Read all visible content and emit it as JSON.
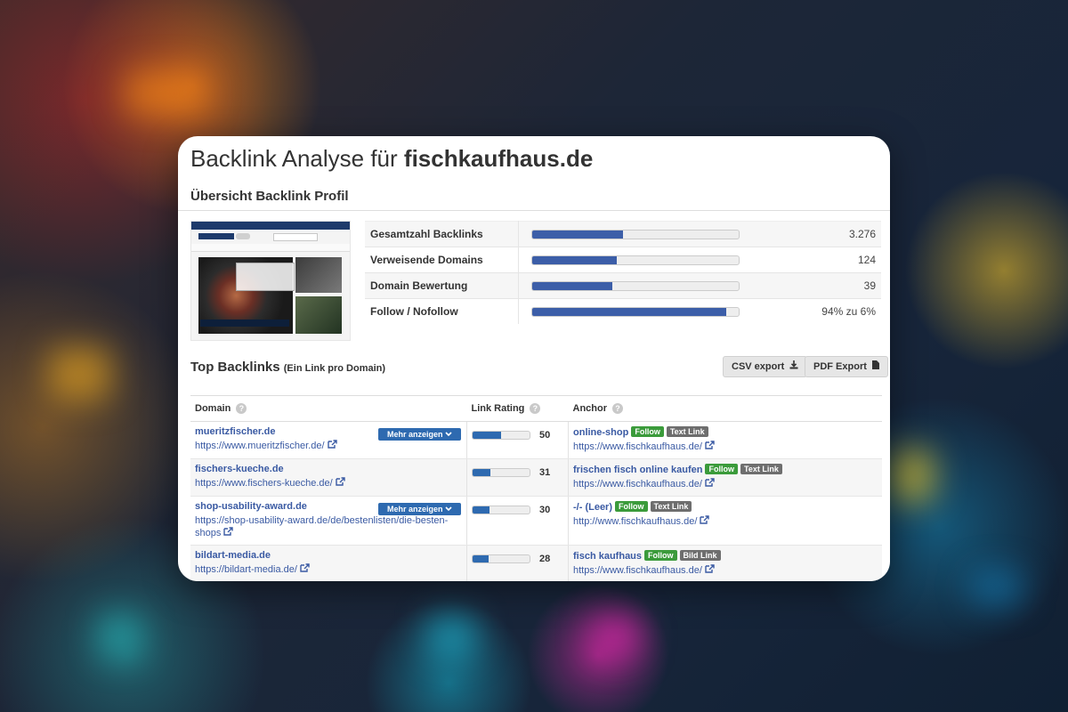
{
  "header": {
    "title_prefix": "Backlink Analyse für",
    "domain": "fischkaufhaus.de"
  },
  "overview": {
    "title": "Übersicht Backlink Profil",
    "rows": [
      {
        "label": "Gesamtzahl Backlinks",
        "value": "3.276",
        "fill": 0.44
      },
      {
        "label": "Verweisende Domains",
        "value": "124",
        "fill": 0.41
      },
      {
        "label": "Domain Bewertung",
        "value": "39",
        "fill": 0.39
      },
      {
        "label": "Follow / Nofollow",
        "value": "94% zu 6%",
        "fill": 0.94
      }
    ]
  },
  "top_backlinks": {
    "title": "Top Backlinks",
    "subtitle": "(Ein Link pro Domain)",
    "csv_label": "CSV export",
    "pdf_label": "PDF Export",
    "headers": {
      "domain": "Domain",
      "rating": "Link Rating",
      "anchor": "Anchor"
    },
    "help": "?",
    "more_label": "Mehr anzeigen",
    "rows": [
      {
        "domain": "mueritzfischer.de",
        "url": "https://www.mueritzfischer.de/",
        "more": true,
        "rating": 50,
        "anchor": "online-shop",
        "follow": "Follow",
        "type": "Text Link",
        "target": "https://www.fischkaufhaus.de/"
      },
      {
        "domain": "fischers-kueche.de",
        "url": "https://www.fischers-kueche.de/",
        "more": false,
        "rating": 31,
        "anchor": "frischen fisch online kaufen",
        "follow": "Follow",
        "type": "Text Link",
        "target": "https://www.fischkaufhaus.de/"
      },
      {
        "domain": "shop-usability-award.de",
        "url": "https://shop-usability-award.de/de/bestenlisten/die-besten-shops",
        "more": true,
        "rating": 30,
        "anchor": "-/- (Leer)",
        "follow": "Follow",
        "type": "Text Link",
        "target": "http://www.fischkaufhaus.de/"
      },
      {
        "domain": "bildart-media.de",
        "url": "https://bildart-media.de/",
        "more": false,
        "rating": 28,
        "anchor": "fisch kaufhaus",
        "follow": "Follow",
        "type": "Bild Link",
        "target": "https://www.fischkaufhaus.de/"
      }
    ]
  },
  "colors": {
    "bar": "#3c5ea8",
    "rating_bar": "#2e6ab0",
    "follow_badge": "#3b9b3b",
    "link": "#3a5aa3"
  },
  "icons": {
    "external": "external-link-icon",
    "download": "download-icon",
    "file": "file-icon",
    "help": "help-icon",
    "chevron": "chevron-down-icon"
  }
}
